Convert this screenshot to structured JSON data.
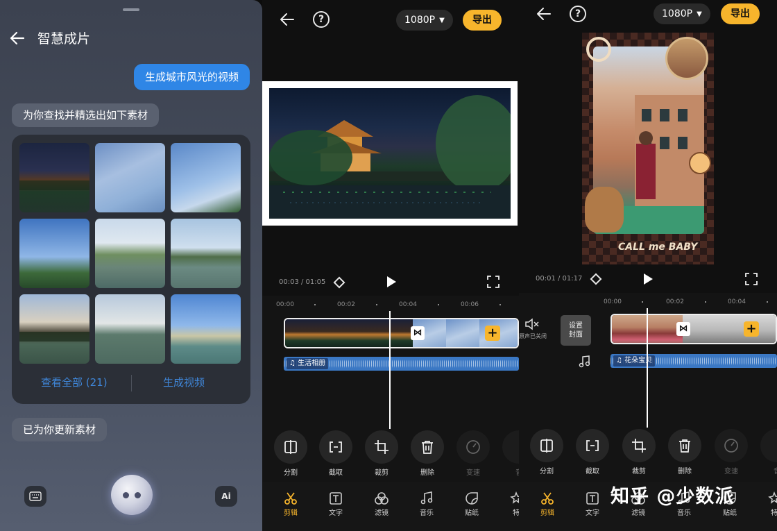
{
  "chat": {
    "title": "智慧成片",
    "user_message": "生成城市风光的视频",
    "bot_message_1": "为你查找并精选出如下素材",
    "view_all": "查看全部 (21)",
    "generate": "生成视频",
    "bot_message_2": "已为你更新素材",
    "ai_button": "Ai"
  },
  "editor_left": {
    "resolution": "1080P",
    "export": "导出",
    "time": "00:03 / 01:05",
    "ruler": [
      "00:00",
      "00:02",
      "00:04",
      "00:06"
    ],
    "audio_label": "♫ 生活相册",
    "tools": [
      "分割",
      "截取",
      "裁剪",
      "删除",
      "变速",
      "音"
    ],
    "tabs": [
      "剪辑",
      "文字",
      "滤镜",
      "音乐",
      "贴纸",
      "特"
    ]
  },
  "editor_right": {
    "resolution": "1080P",
    "export": "导出",
    "time": "00:01 / 01:17",
    "ruler": [
      "00:00",
      "00:02",
      "00:04"
    ],
    "mute_label": "原声已关闭",
    "cover_label_1": "设置",
    "cover_label_2": "封面",
    "audio_label": "♫ 花朵宝贝",
    "sticker_text": "CALL me BABY",
    "tools": [
      "分割",
      "截取",
      "裁剪",
      "删除",
      "变速",
      "音"
    ],
    "tabs": [
      "剪辑",
      "文字",
      "滤镜",
      "音乐",
      "贴纸",
      "特"
    ]
  },
  "watermark": "知乎 @少数派",
  "colors": {
    "accent": "#f7b52c",
    "link": "#3f86d8",
    "user_bubble": "#2f86e6",
    "audio": "#3b78c4"
  }
}
